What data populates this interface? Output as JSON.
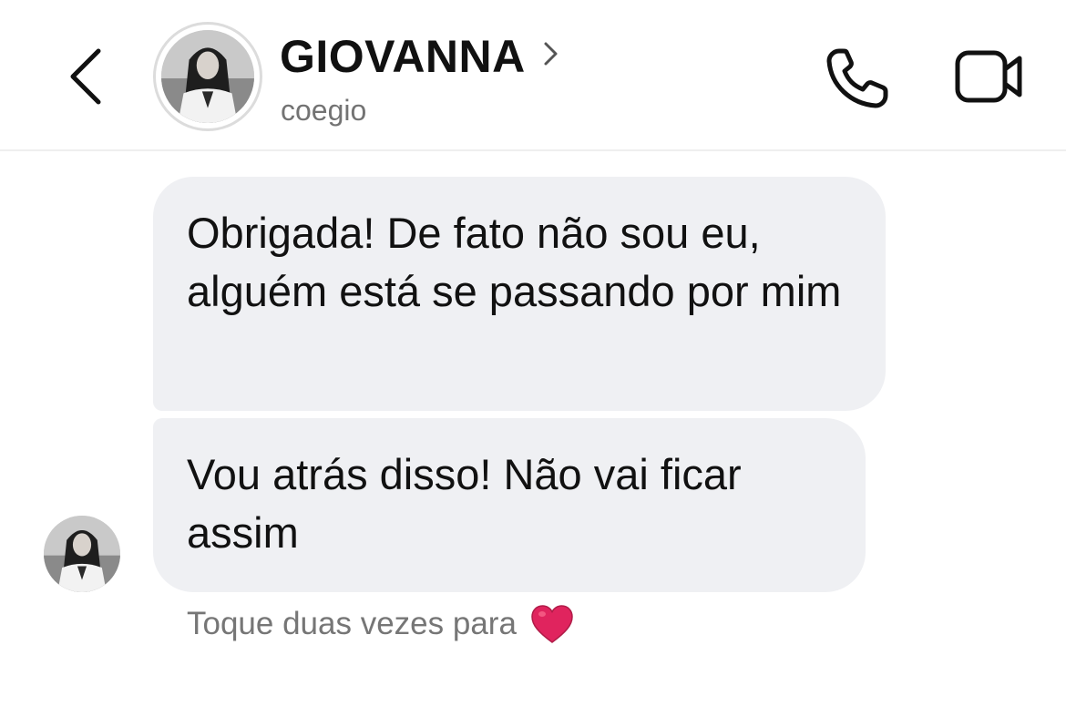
{
  "header": {
    "contact_name": "GIOVANNA",
    "username": "coegio",
    "icons": {
      "back": "chevron-left-icon",
      "profile": "chevron-right-icon",
      "call": "phone-icon",
      "video": "video-camera-icon"
    }
  },
  "messages": [
    {
      "sender": "contact",
      "text": "Obrigada! De fato não sou eu, alguém está se passando por mim"
    },
    {
      "sender": "contact",
      "text": "Vou atrás disso! Não vai ficar assim"
    }
  ],
  "reaction_hint": {
    "text": "Toque duas vezes para",
    "icon": "heart-icon"
  },
  "colors": {
    "bubble": "#eff0f3",
    "text": "#111111",
    "secondary_text": "#737373",
    "heart": "#e0245e"
  }
}
